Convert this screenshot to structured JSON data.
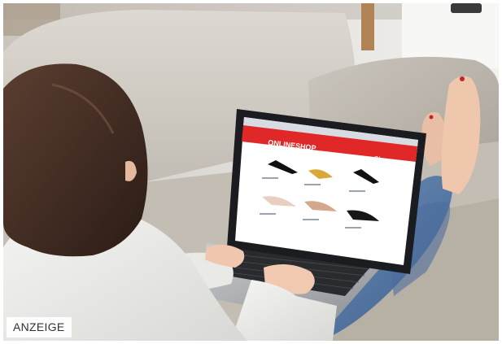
{
  "photo": {
    "description_icon": "woman-laptop-shopping-photo",
    "screen": {
      "logo": "ONLINESHOP",
      "category": "Shoes"
    }
  },
  "badge": {
    "label": "ANZEIGE"
  },
  "colors": {
    "shop_red": "#e02828",
    "sofa": "#cfcac2",
    "jeans": "#5b7fae"
  }
}
